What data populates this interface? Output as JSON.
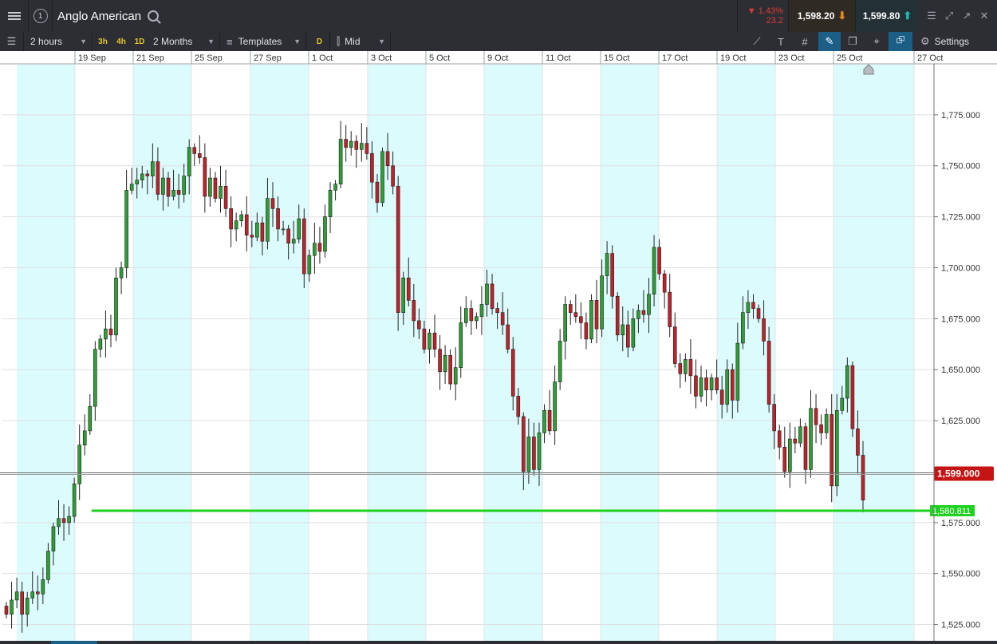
{
  "header": {
    "instrument": "Anglo American",
    "window_count": "1",
    "change_pct": "▼ 1.43%",
    "change_abs": "23.2",
    "sell_price": "1,598.20",
    "buy_price": "1,599.80"
  },
  "toolbar": {
    "interval": "2 hours",
    "quick_intervals": [
      "3h",
      "4h",
      "1D"
    ],
    "range": "2 Months",
    "templates": "Templates",
    "daily_badge": "D",
    "price_type": "Mid",
    "settings": "Settings"
  },
  "colors": {
    "bull": "#2e9e35",
    "bear": "#c0222a",
    "band": "#dcfbfd",
    "support": "#1fd21f",
    "price_label": "#c41414"
  },
  "chart_data": {
    "type": "candlestick",
    "x_tick_labels": [
      "19 Sep",
      "21 Sep",
      "25 Sep",
      "27 Sep",
      "1 Oct",
      "3 Oct",
      "5 Oct",
      "9 Oct",
      "11 Oct",
      "15 Oct",
      "17 Oct",
      "19 Oct",
      "23 Oct",
      "25 Oct",
      "27 Oct"
    ],
    "y_tick_labels": [
      "1,775.000",
      "1,750.000",
      "1,725.000",
      "1,700.000",
      "1,675.000",
      "1,650.000",
      "1,625.000",
      "1,575.000",
      "1,550.000",
      "1,525.000"
    ],
    "y_ticks": [
      1775,
      1750,
      1725,
      1700,
      1675,
      1650,
      1625,
      1575,
      1550,
      1525
    ],
    "ylim": [
      1517,
      1800
    ],
    "current_price": 1599.0,
    "current_price_label": "1,599.000",
    "support_level": 1580.811,
    "support_label": "1,580.811",
    "grid": true,
    "closes": [
      1530,
      1537,
      1541,
      1530,
      1538,
      1541,
      1540,
      1547,
      1561,
      1573,
      1577,
      1575,
      1578,
      1594,
      1613,
      1620,
      1632,
      1660,
      1665,
      1670,
      1667,
      1695,
      1700,
      1738,
      1741,
      1743,
      1746,
      1745,
      1752,
      1736,
      1744,
      1735,
      1738,
      1736,
      1745,
      1759,
      1756,
      1754,
      1735,
      1744,
      1734,
      1740,
      1729,
      1719,
      1723,
      1726,
      1716,
      1715,
      1722,
      1713,
      1734,
      1729,
      1719,
      1719,
      1712,
      1714,
      1724,
      1697,
      1706,
      1712,
      1708,
      1725,
      1738,
      1741,
      1763,
      1759,
      1762,
      1758,
      1761,
      1756,
      1742,
      1732,
      1757,
      1750,
      1740,
      1678,
      1695,
      1684,
      1674,
      1670,
      1660,
      1668,
      1660,
      1649,
      1657,
      1643,
      1651,
      1673,
      1680,
      1674,
      1676,
      1682,
      1692,
      1680,
      1678,
      1672,
      1660,
      1637,
      1627,
      1600,
      1617,
      1601,
      1619,
      1630,
      1620,
      1644,
      1664,
      1682,
      1678,
      1676,
      1673,
      1665,
      1684,
      1670,
      1696,
      1707,
      1686,
      1667,
      1672,
      1661,
      1675,
      1679,
      1677,
      1687,
      1710,
      1697,
      1688,
      1671,
      1653,
      1648,
      1655,
      1647,
      1637,
      1646,
      1640,
      1646,
      1640,
      1633,
      1650,
      1635,
      1663,
      1678,
      1683,
      1680,
      1675,
      1664,
      1633,
      1620,
      1612,
      1600,
      1616,
      1614,
      1622,
      1601,
      1631,
      1623,
      1619,
      1628,
      1593,
      1630,
      1636,
      1652,
      1621,
      1608,
      1586
    ]
  }
}
